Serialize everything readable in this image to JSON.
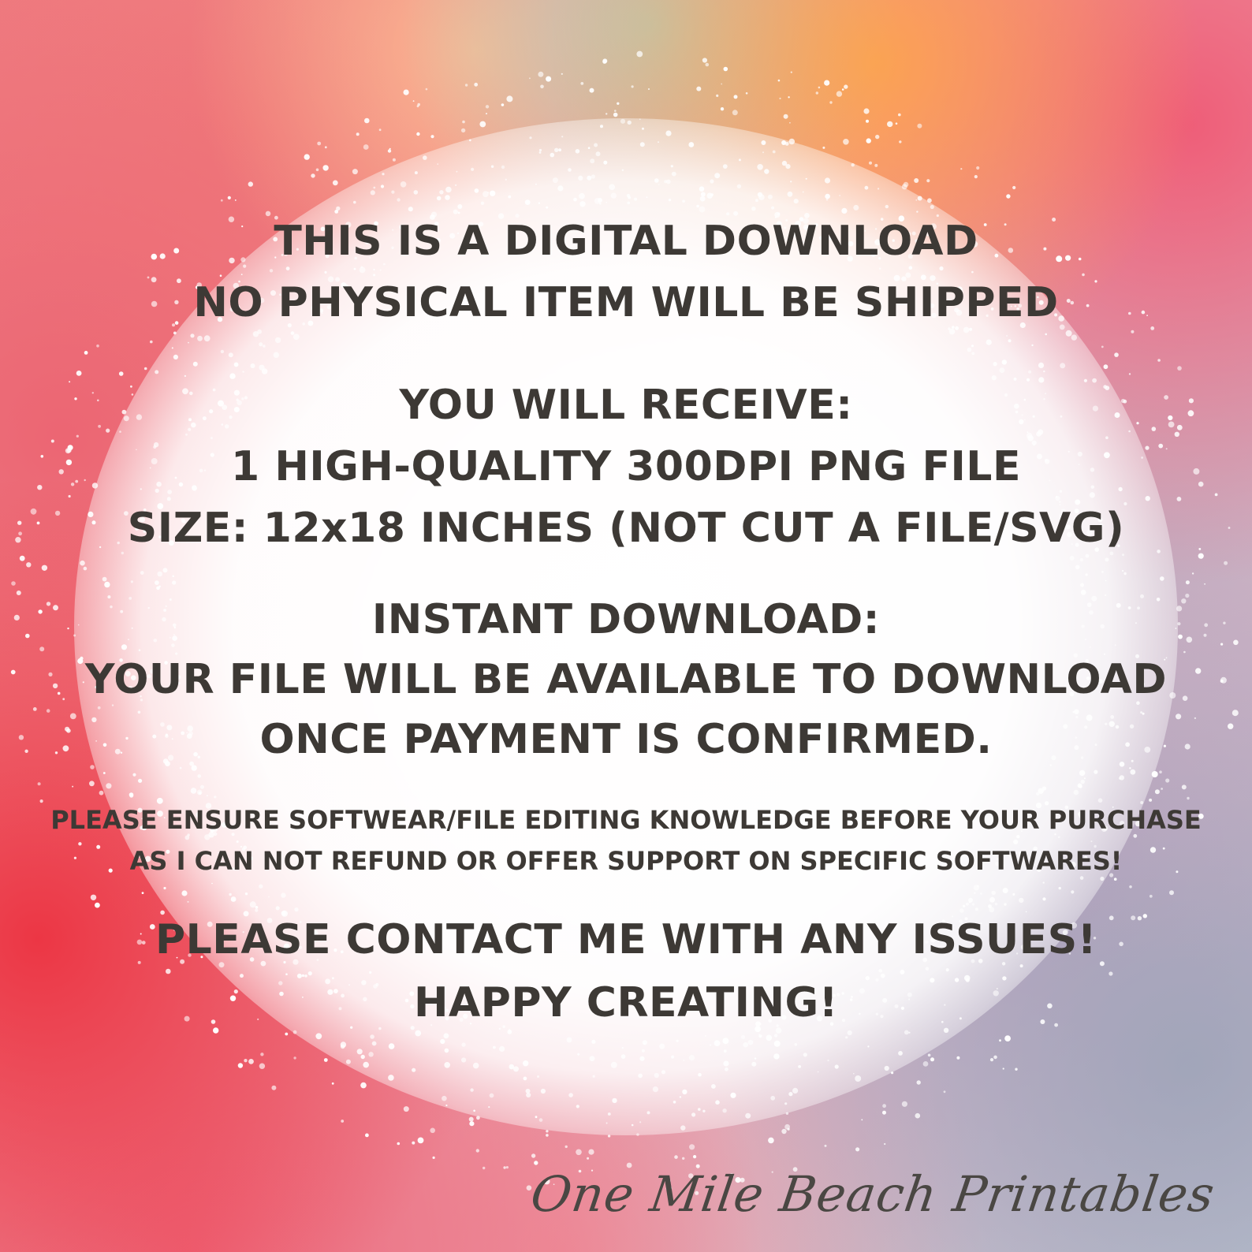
{
  "notice": {
    "heading_1": "THIS IS A DIGITAL DOWNLOAD",
    "heading_2": "NO PHYSICAL ITEM WILL BE SHIPPED",
    "receive_title": "YOU WILL RECEIVE:",
    "receive_item": "1 HIGH-QUALITY 300DPI PNG FILE",
    "receive_size": "SIZE: 12x18 INCHES (NOT CUT A FILE/SVG)",
    "instant_title": "INSTANT DOWNLOAD:",
    "instant_line_1": "YOUR FILE WILL BE AVAILABLE TO DOWNLOAD",
    "instant_line_2": "ONCE PAYMENT IS CONFIRMED.",
    "disclaimer_1": "PLEASE ENSURE SOFTWEAR/FILE EDITING KNOWLEDGE BEFORE YOUR PURCHASE",
    "disclaimer_2": "AS I CAN NOT REFUND OR OFFER SUPPORT ON SPECIFIC SOFTWARES!",
    "contact": "PLEASE CONTACT ME WITH ANY ISSUES!",
    "closing": "HAPPY CREATING!"
  },
  "brand": {
    "signature": "One Mile Beach Printables"
  },
  "colors": {
    "text": "#3d3935",
    "splash": "#ffffff"
  }
}
